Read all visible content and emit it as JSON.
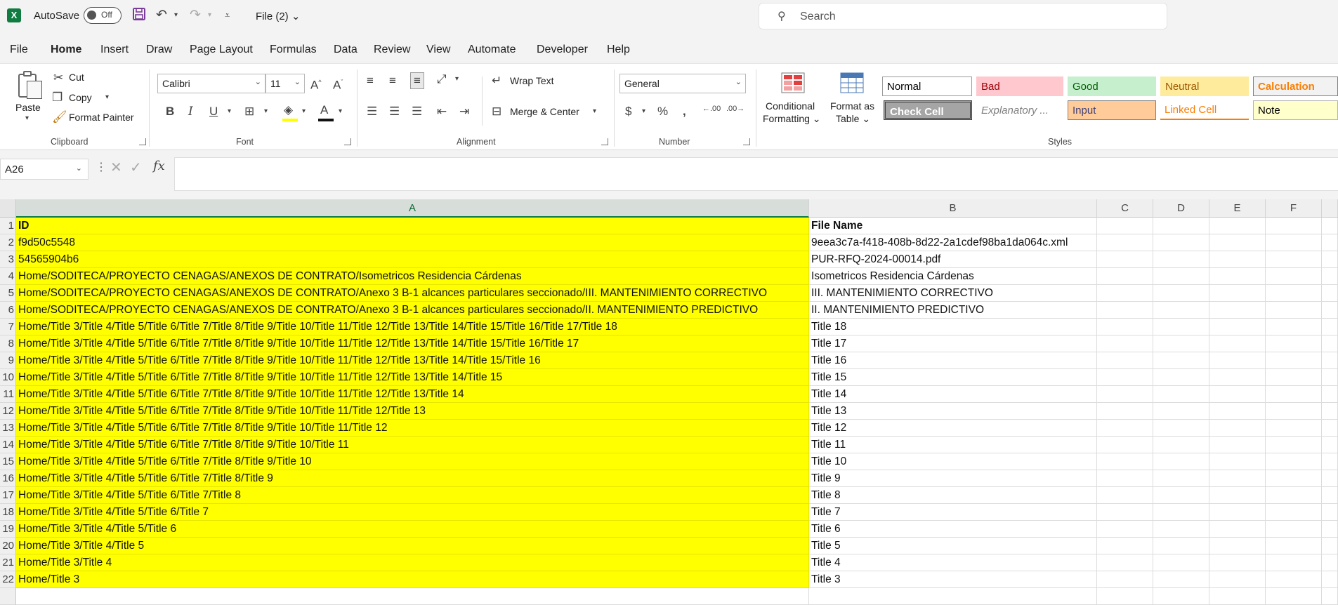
{
  "titlebar": {
    "autosave_label": "AutoSave",
    "autosave_state": "Off",
    "file_title": "File (2)",
    "search_placeholder": "Search"
  },
  "menu": {
    "tabs": [
      "File",
      "Home",
      "Insert",
      "Draw",
      "Page Layout",
      "Formulas",
      "Data",
      "Review",
      "View",
      "Automate",
      "Developer",
      "Help"
    ],
    "active": "Home"
  },
  "ribbon": {
    "clipboard": {
      "paste": "Paste",
      "cut": "Cut",
      "copy": "Copy",
      "format_painter": "Format Painter",
      "label": "Clipboard"
    },
    "font": {
      "name": "Calibri",
      "size": "11",
      "label": "Font"
    },
    "alignment": {
      "wrap_text": "Wrap Text",
      "merge_center": "Merge & Center",
      "label": "Alignment"
    },
    "number": {
      "format": "General",
      "label": "Number"
    },
    "styles": {
      "conditional_formatting": [
        "Conditional",
        "Formatting"
      ],
      "format_as_table": [
        "Format as",
        "Table"
      ],
      "cells": [
        {
          "label": "Normal",
          "bg": "#ffffff",
          "fg": "#000000",
          "border": "#9a9a9a"
        },
        {
          "label": "Bad",
          "bg": "#ffc7ce",
          "fg": "#9c0006",
          "border": "#ffc7ce"
        },
        {
          "label": "Good",
          "bg": "#c6efce",
          "fg": "#006100",
          "border": "#c6efce"
        },
        {
          "label": "Neutral",
          "bg": "#ffeb9c",
          "fg": "#9c5700",
          "border": "#ffeb9c"
        },
        {
          "label": "Calculation",
          "bg": "#f2f2f2",
          "fg": "#fa7d00",
          "border": "#7f7f7f"
        },
        {
          "label": "Check Cell",
          "bg": "#a5a5a5",
          "fg": "#ffffff",
          "border": "#3f3f3f"
        },
        {
          "label": "Explanatory ...",
          "bg": "#ffffff",
          "fg": "#7f7f7f",
          "border": "#ffffff"
        },
        {
          "label": "Input",
          "bg": "#ffcc99",
          "fg": "#3f3f76",
          "border": "#7f7f7f"
        },
        {
          "label": "Linked Cell",
          "bg": "#ffffff",
          "fg": "#fa7d00",
          "border": "#ffffff"
        },
        {
          "label": "Note",
          "bg": "#ffffcc",
          "fg": "#000000",
          "border": "#b2b2b2"
        }
      ],
      "label": "Styles"
    }
  },
  "formula_bar": {
    "name_box": "A26",
    "fx": "fx",
    "value": ""
  },
  "grid": {
    "columns": [
      "A",
      "B",
      "C",
      "D",
      "E",
      "F"
    ],
    "selected_column": "A",
    "row_numbers": [
      "1",
      "2",
      "3",
      "4",
      "5",
      "6",
      "7",
      "8",
      "9",
      "10",
      "11",
      "12",
      "13",
      "14",
      "15",
      "16",
      "17",
      "18",
      "19",
      "20",
      "21",
      "22"
    ],
    "rows": [
      {
        "a": "ID",
        "b": "File Name"
      },
      {
        "a": "f9d50c5548",
        "b": "9eea3c7a-f418-408b-8d22-2a1cdef98ba1da064c.xml"
      },
      {
        "a": "54565904b6",
        "b": "PUR-RFQ-2024-00014.pdf"
      },
      {
        "a": "Home/SODITECA/PROYECTO CENAGAS/ANEXOS DE CONTRATO/Isometricos Residencia Cárdenas",
        "b": "Isometricos Residencia Cárdenas"
      },
      {
        "a": "Home/SODITECA/PROYECTO CENAGAS/ANEXOS DE CONTRATO/Anexo 3 B-1 alcances particulares seccionado/III. MANTENIMIENTO CORRECTIVO",
        "b": "III. MANTENIMIENTO CORRECTIVO"
      },
      {
        "a": "Home/SODITECA/PROYECTO CENAGAS/ANEXOS DE CONTRATO/Anexo 3 B-1 alcances particulares seccionado/II. MANTENIMIENTO PREDICTIVO",
        "b": "II. MANTENIMIENTO PREDICTIVO"
      },
      {
        "a": "Home/Title 3/Title 4/Title 5/Title 6/Title 7/Title 8/Title 9/Title 10/Title 11/Title 12/Title 13/Title 14/Title 15/Title 16/Title 17/Title 18",
        "b": "Title 18"
      },
      {
        "a": "Home/Title 3/Title 4/Title 5/Title 6/Title 7/Title 8/Title 9/Title 10/Title 11/Title 12/Title 13/Title 14/Title 15/Title 16/Title 17",
        "b": "Title 17"
      },
      {
        "a": "Home/Title 3/Title 4/Title 5/Title 6/Title 7/Title 8/Title 9/Title 10/Title 11/Title 12/Title 13/Title 14/Title 15/Title 16",
        "b": "Title 16"
      },
      {
        "a": "Home/Title 3/Title 4/Title 5/Title 6/Title 7/Title 8/Title 9/Title 10/Title 11/Title 12/Title 13/Title 14/Title 15",
        "b": "Title 15"
      },
      {
        "a": "Home/Title 3/Title 4/Title 5/Title 6/Title 7/Title 8/Title 9/Title 10/Title 11/Title 12/Title 13/Title 14",
        "b": "Title 14"
      },
      {
        "a": "Home/Title 3/Title 4/Title 5/Title 6/Title 7/Title 8/Title 9/Title 10/Title 11/Title 12/Title 13",
        "b": "Title 13"
      },
      {
        "a": "Home/Title 3/Title 4/Title 5/Title 6/Title 7/Title 8/Title 9/Title 10/Title 11/Title 12",
        "b": "Title 12"
      },
      {
        "a": "Home/Title 3/Title 4/Title 5/Title 6/Title 7/Title 8/Title 9/Title 10/Title 11",
        "b": "Title 11"
      },
      {
        "a": "Home/Title 3/Title 4/Title 5/Title 6/Title 7/Title 8/Title 9/Title 10",
        "b": "Title 10"
      },
      {
        "a": "Home/Title 3/Title 4/Title 5/Title 6/Title 7/Title 8/Title 9",
        "b": "Title 9"
      },
      {
        "a": "Home/Title 3/Title 4/Title 5/Title 6/Title 7/Title 8",
        "b": "Title 8"
      },
      {
        "a": "Home/Title 3/Title 4/Title 5/Title 6/Title 7",
        "b": "Title 7"
      },
      {
        "a": "Home/Title 3/Title 4/Title 5/Title 6",
        "b": "Title 6"
      },
      {
        "a": "Home/Title 3/Title 4/Title 5",
        "b": "Title 5"
      },
      {
        "a": "Home/Title 3/Title 4",
        "b": "Title 4"
      },
      {
        "a": "Home/Title 3",
        "b": "Title 3"
      }
    ],
    "highlight_color": "#ffff00"
  },
  "icons": [
    "excel-logo-icon",
    "save-icon",
    "undo-icon",
    "redo-icon",
    "search-icon",
    "scissors-icon",
    "copy-icon",
    "paintbrush-icon",
    "bold-icon",
    "italic-icon",
    "underline-icon",
    "borders-icon",
    "fill-color-icon",
    "font-color-icon",
    "wrap-text-icon",
    "merge-icon",
    "currency-icon",
    "percent-icon",
    "comma-icon",
    "conditional-formatting-icon",
    "format-as-table-icon",
    "cancel-icon",
    "enter-icon"
  ]
}
